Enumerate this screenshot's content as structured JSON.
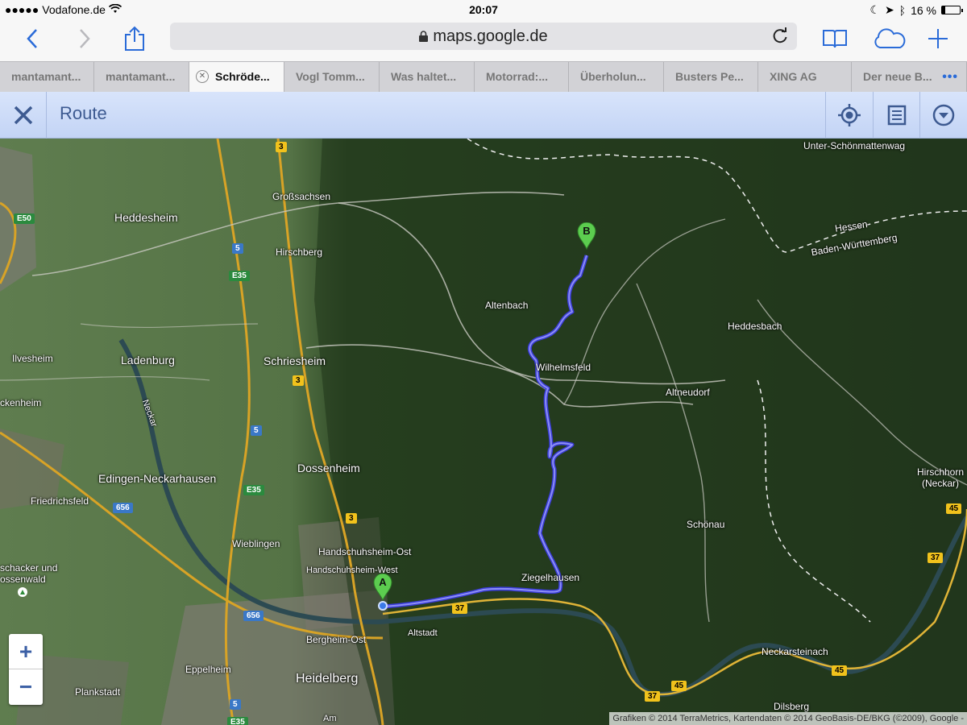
{
  "status_bar": {
    "carrier": "Vodafone.de",
    "time": "20:07",
    "battery_percent": "16 %",
    "battery_level": 0.16
  },
  "browser": {
    "url": "maps.google.de",
    "tabs": [
      {
        "label": "mantamant...",
        "active": false
      },
      {
        "label": "mantamant...",
        "active": false
      },
      {
        "label": "Schröde...",
        "active": true
      },
      {
        "label": "Vogl Tomm...",
        "active": false
      },
      {
        "label": "Was haltet...",
        "active": false
      },
      {
        "label": "Motorrad:...",
        "active": false
      },
      {
        "label": "Überholun...",
        "active": false
      },
      {
        "label": "Busters Pe...",
        "active": false
      },
      {
        "label": "XING AG",
        "active": false
      },
      {
        "label": "Der neue B...",
        "active": false
      }
    ],
    "tab_more": "•••"
  },
  "maps_header": {
    "title": "Route"
  },
  "map": {
    "places": [
      "Unter-Schönmattenwag",
      "Großsachsen",
      "Heddesheim",
      "Hirschberg",
      "Hessen",
      "Baden-Württemberg",
      "Altenbach",
      "Heddesbach",
      "Ilvesheim",
      "Ladenburg",
      "Schriesheim",
      "Wilhelmsfeld",
      "Altneudorf",
      "ckenheim",
      "Neckar",
      "Edingen-Neckarhausen",
      "Dossenheim",
      "Friedrichsfeld",
      "Hirschhorn\n(Neckar)",
      "Schönau",
      "Wieblingen",
      "Handschuhsheim-Ost",
      "Handschuhsheim-West",
      "schacker und",
      "ossenwald",
      "Ziegelhausen",
      "Altstadt",
      "Bergheim-Ost",
      "Neckarsteinach",
      "Eppelheim",
      "Heidelberg",
      "Plankstadt",
      "Dilsberg",
      "Am"
    ],
    "shields": [
      "3",
      "E50",
      "5",
      "E35",
      "3",
      "5",
      "E35",
      "656",
      "3",
      "656",
      "37",
      "45",
      "37",
      "37",
      "45",
      "45",
      "5",
      "E35"
    ],
    "markers": {
      "start": "A",
      "end": "B"
    },
    "route_color": "#4b4ff2",
    "attribution": "Grafiken © 2014 TerraMetrics, Kartendaten © 2014 GeoBasis-DE/BKG (©2009), Google -",
    "zoom_in": "+",
    "zoom_out": "−"
  }
}
